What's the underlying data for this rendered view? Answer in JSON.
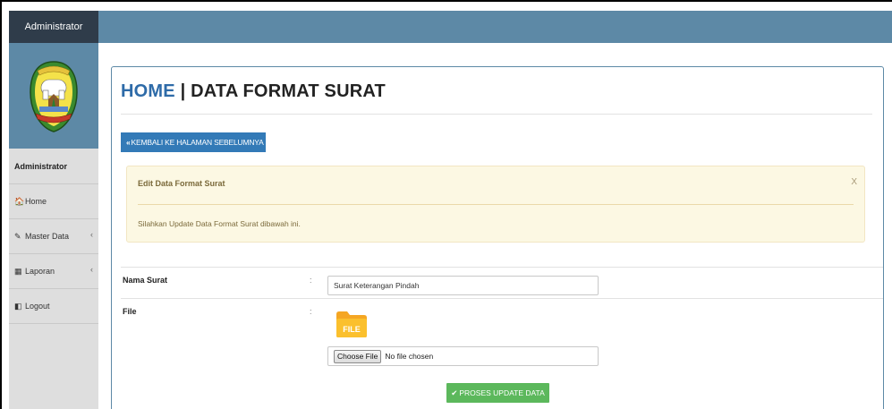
{
  "sidebar": {
    "brand": "Administrator",
    "user": "Administrator",
    "items": [
      {
        "icon": "home-icon",
        "glyph": "🏠",
        "label": "Home",
        "has_chevron": false
      },
      {
        "icon": "edit-icon",
        "glyph": "✎",
        "label": "Master Data",
        "has_chevron": true
      },
      {
        "icon": "calendar-icon",
        "glyph": "▦",
        "label": "Laporan",
        "has_chevron": true
      },
      {
        "icon": "logout-icon",
        "glyph": "◧",
        "label": "Logout",
        "has_chevron": false
      }
    ],
    "chevron": "‹"
  },
  "header": {
    "title_home": "HOME",
    "title_sep": " | ",
    "title_rest": "DATA FORMAT SURAT"
  },
  "back_button": {
    "icon": "double-chevron-left-icon",
    "glyph": "«",
    "label": "KEMBALI KE HALAMAN SEBELUMNYA"
  },
  "alert": {
    "title": "Edit Data Format Surat",
    "close": "X",
    "body": "Silahkan Update Data Format Surat dibawah ini."
  },
  "form": {
    "nama_surat": {
      "label": "Nama Surat",
      "colon": ":",
      "value": "Surat Keterangan Pindah"
    },
    "file": {
      "label": "File",
      "colon": ":",
      "icon_text": "FILE",
      "choose_label": "Choose File",
      "no_file_text": "No file chosen"
    },
    "submit": {
      "icon": "check-icon",
      "glyph": "✔",
      "label": "PROSES UPDATE DATA"
    }
  },
  "colors": {
    "topbar": "#5d89a6",
    "brand": "#2f3c4a",
    "primary": "#337ab7",
    "success": "#5cb85c",
    "warning_bg": "#fcf8e3",
    "title_home": "#2e6ba8"
  }
}
